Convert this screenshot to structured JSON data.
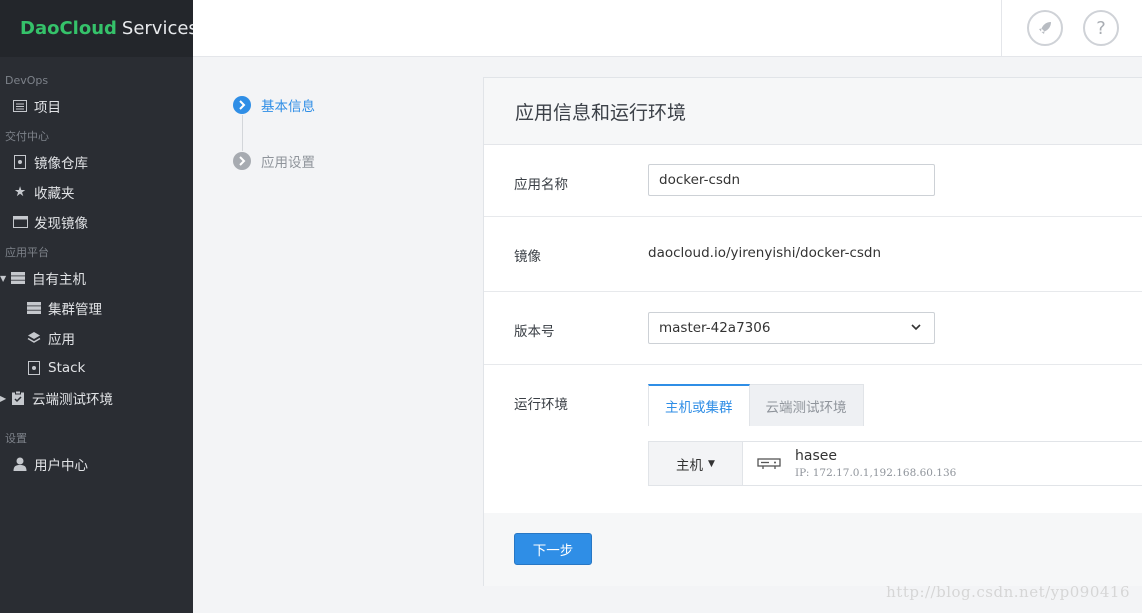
{
  "brand": {
    "part1": "DaoCloud",
    "part2": "Services"
  },
  "sidebar": {
    "sections": {
      "devops": "DevOps",
      "delivery": "交付中心",
      "platform": "应用平台",
      "settings": "设置"
    },
    "items": {
      "projects": "项目",
      "image_repo": "镜像仓库",
      "favorites": "收藏夹",
      "discover_images": "发现镜像",
      "own_hosts": "自有主机",
      "cluster_mgmt": "集群管理",
      "apps": "应用",
      "stack": "Stack",
      "cloud_test_env": "云端测试环境",
      "user_center": "用户中心"
    }
  },
  "header": {
    "rocket_icon": "rocket-icon",
    "help_label": "?"
  },
  "steps": [
    {
      "label": "基本信息",
      "state": "active"
    },
    {
      "label": "应用设置",
      "state": "inactive"
    }
  ],
  "card": {
    "title": "应用信息和运行环境",
    "app_name": {
      "label": "应用名称",
      "value": "docker-csdn"
    },
    "image": {
      "label": "镜像",
      "value": "daocloud.io/yirenyishi/docker-csdn"
    },
    "version": {
      "label": "版本号",
      "value": "master-42a7306"
    },
    "runtime": {
      "label": "运行环境",
      "tabs": [
        "主机或集群",
        "云端测试环境"
      ],
      "host_type": "主机",
      "host_name": "hasee",
      "host_ip": "IP: 172.17.0.1,192.168.60.136"
    },
    "next_button": "下一步"
  },
  "watermark": "http://blog.csdn.net/yp090416",
  "colors": {
    "accent": "#2f8ee6",
    "brand_green": "#35c26a",
    "sidebar_bg": "#2a2d33"
  }
}
